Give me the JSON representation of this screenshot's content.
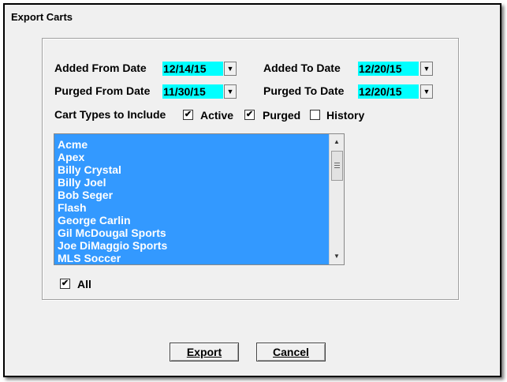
{
  "window": {
    "title": "Export Carts"
  },
  "filters": {
    "added_from_label": "Added From Date",
    "added_from_value": "12/14/15",
    "added_to_label": "Added To Date",
    "added_to_value": "12/20/15",
    "purged_from_label": "Purged From Date",
    "purged_from_value": "11/30/15",
    "purged_to_label": "Purged To Date",
    "purged_to_value": "12/20/15"
  },
  "cart_types": {
    "label": "Cart Types to Include",
    "active": {
      "label": "Active",
      "checked": true
    },
    "purged": {
      "label": "Purged",
      "checked": true
    },
    "history": {
      "label": "History",
      "checked": false
    }
  },
  "list": {
    "items": [
      "Acme",
      "Apex",
      "Billy Crystal",
      "Billy Joel",
      "Bob Seger",
      "Flash",
      "George Carlin",
      "Gil McDougal Sports",
      "Joe DiMaggio Sports",
      "MLS Soccer"
    ],
    "selected_color": "#3399ff"
  },
  "all_checkbox": {
    "label": "All",
    "checked": true
  },
  "buttons": {
    "export": "Export",
    "cancel": "Cancel"
  },
  "colors": {
    "date_highlight": "#00ffff"
  }
}
